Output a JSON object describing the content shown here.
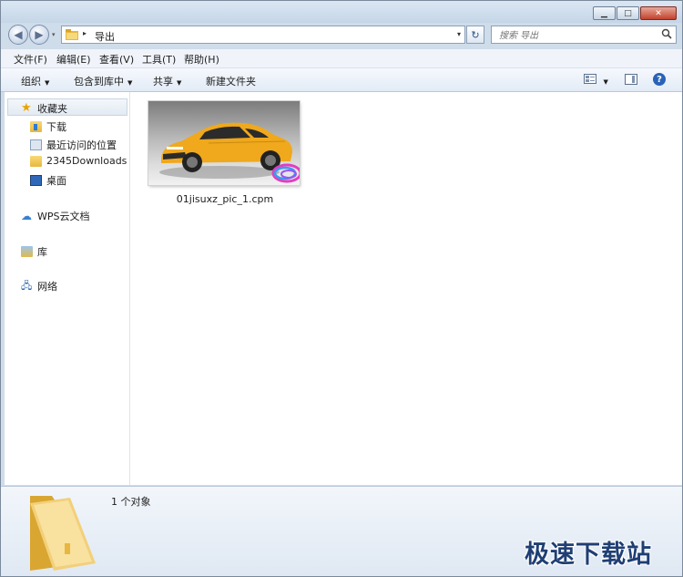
{
  "window": {
    "minimize": "▁",
    "maximize": "□",
    "close": "✕"
  },
  "nav": {
    "back": "◀",
    "forward": "▶",
    "recent": "▾"
  },
  "address": {
    "separator": "▸",
    "crumb": "导出",
    "dropdown": "▾",
    "refresh": "↻"
  },
  "search": {
    "placeholder": "搜索 导出",
    "icon": "search-icon"
  },
  "menubar": {
    "items": [
      "文件(F)",
      "编辑(E)",
      "查看(V)",
      "工具(T)",
      "帮助(H)"
    ]
  },
  "toolbar": {
    "organize": "组织",
    "include_in_library": "包含到库中",
    "share": "共享",
    "new_folder": "新建文件夹",
    "dropdown_arrow": "▼",
    "help": "?"
  },
  "navpane": {
    "favorites": "收藏夹",
    "downloads": "下载",
    "recent_places": "最近访问的位置",
    "downloads_2345": "2345Downloads",
    "desktop": "桌面",
    "wps_cloud": "WPS云文档",
    "libraries": "库",
    "network": "网络"
  },
  "file": {
    "name": "01jisuxz_pic_1.cpm"
  },
  "details": {
    "count": "1 个对象"
  },
  "watermark": "极速下载站",
  "colors": {
    "accent": "#2a63b6",
    "car_body": "#f0a81c",
    "folder": "#e7b73f"
  }
}
